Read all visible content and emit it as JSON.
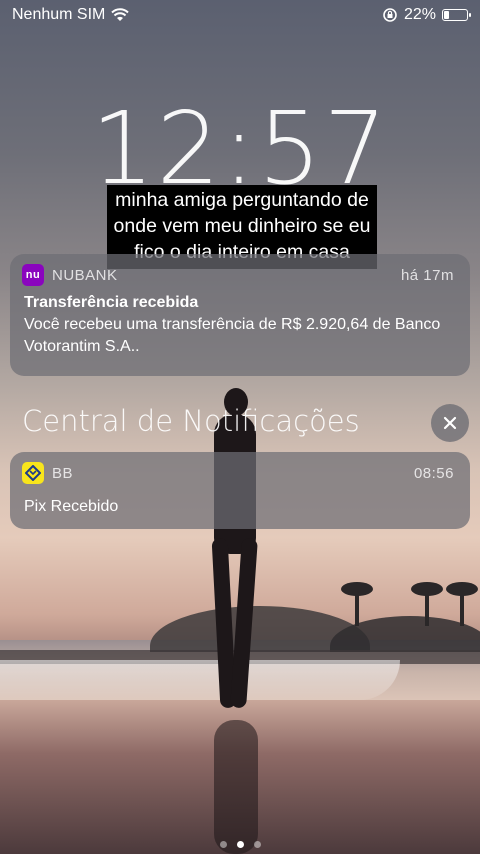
{
  "status_bar": {
    "carrier": "Nenhum SIM",
    "battery_percent": "22%",
    "battery_level": 0.22
  },
  "clock": {
    "time": "12:57"
  },
  "caption": {
    "text": "minha amiga perguntando de onde vem meu dinheiro se eu fico o dia inteiro em casa"
  },
  "notifications": [
    {
      "app": "NUBANK",
      "icon_label": "nu",
      "time": "há 17m",
      "title": "Transferência recebida",
      "body": "Você recebeu uma transferência de R$ 2.920,64 de Banco Votorantim S.A.."
    },
    {
      "app": "BB",
      "time": "08:56",
      "body": "Pix Recebido"
    }
  ],
  "notification_center": {
    "title": "Central de Notificações"
  },
  "colors": {
    "nubank": "#8a05be",
    "bb": "#f8e51c"
  },
  "page_dots": {
    "count": 3,
    "active": 1
  }
}
